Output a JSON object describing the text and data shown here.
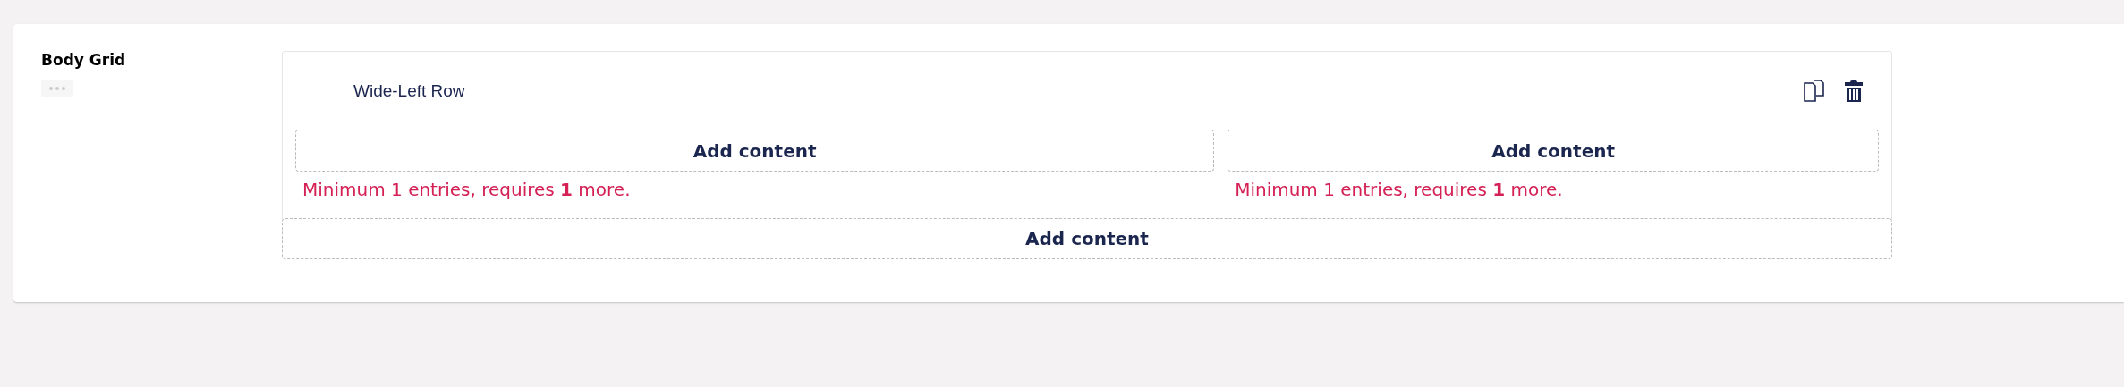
{
  "property": {
    "label": "Body Grid"
  },
  "row": {
    "title": "Wide-Left Row",
    "areas": [
      {
        "add_label": "Add content",
        "error": "Minimum 1 entries, requires **1** more."
      },
      {
        "add_label": "Add content",
        "error": "Minimum 1 entries, requires **1** more."
      }
    ]
  },
  "add_row": {
    "label": "Add content"
  }
}
